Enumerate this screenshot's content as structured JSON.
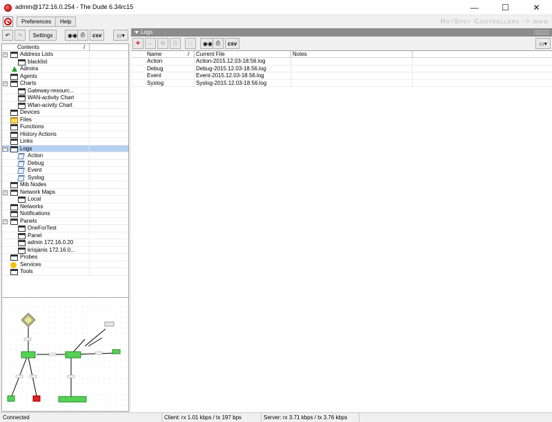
{
  "window": {
    "title": "admin@172.16.0.254 - The Dude 6.34rc15"
  },
  "menu": {
    "preferences": "Preferences",
    "help": "Help",
    "brand": "HotSpot Controllers -> www"
  },
  "left_toolbar": {
    "settings": "Settings",
    "csv": "csv"
  },
  "tree": {
    "header": "Contents",
    "items": [
      {
        "label": "Address Lists",
        "level": 0,
        "exp": "−",
        "icon": "window-icon"
      },
      {
        "label": "blacklist",
        "level": 1,
        "exp": "",
        "icon": "window-icon"
      },
      {
        "label": "Admins",
        "level": 0,
        "exp": "",
        "icon": "admin-icon"
      },
      {
        "label": "Agents",
        "level": 0,
        "exp": "",
        "icon": "window-icon"
      },
      {
        "label": "Charts",
        "level": 0,
        "exp": "−",
        "icon": "window-icon"
      },
      {
        "label": "Gateway-resourc...",
        "level": 1,
        "exp": "",
        "icon": "window-icon"
      },
      {
        "label": "WAN-activity Chart",
        "level": 1,
        "exp": "",
        "icon": "window-icon"
      },
      {
        "label": "Wlan-acivity Chart",
        "level": 1,
        "exp": "",
        "icon": "window-icon"
      },
      {
        "label": "Devices",
        "level": 0,
        "exp": "",
        "icon": "window-icon"
      },
      {
        "label": "Files",
        "level": 0,
        "exp": "",
        "icon": "folder-icon"
      },
      {
        "label": "Functions",
        "level": 0,
        "exp": "",
        "icon": "window-icon"
      },
      {
        "label": "History Actions",
        "level": 0,
        "exp": "",
        "icon": "window-icon"
      },
      {
        "label": "Links",
        "level": 0,
        "exp": "",
        "icon": "window-icon"
      },
      {
        "label": "Logs",
        "level": 0,
        "exp": "−",
        "icon": "window-icon",
        "selected": true
      },
      {
        "label": "Action",
        "level": 1,
        "exp": "",
        "icon": "log-icon"
      },
      {
        "label": "Debug",
        "level": 1,
        "exp": "",
        "icon": "log-icon"
      },
      {
        "label": "Event",
        "level": 1,
        "exp": "",
        "icon": "log-icon"
      },
      {
        "label": "Syslog",
        "level": 1,
        "exp": "",
        "icon": "log-icon"
      },
      {
        "label": "Mib Nodes",
        "level": 0,
        "exp": "",
        "icon": "window-icon"
      },
      {
        "label": "Network Maps",
        "level": 0,
        "exp": "−",
        "icon": "window-icon"
      },
      {
        "label": "Local",
        "level": 1,
        "exp": "",
        "icon": "window-icon"
      },
      {
        "label": "Networks",
        "level": 0,
        "exp": "",
        "icon": "window-icon"
      },
      {
        "label": "Notifications",
        "level": 0,
        "exp": "",
        "icon": "window-icon"
      },
      {
        "label": "Panels",
        "level": 0,
        "exp": "−",
        "icon": "window-icon"
      },
      {
        "label": "OneForTest",
        "level": 1,
        "exp": "",
        "icon": "window-icon"
      },
      {
        "label": "Panel",
        "level": 1,
        "exp": "",
        "icon": "window-icon"
      },
      {
        "label": "admin 172.16.0.20",
        "level": 1,
        "exp": "",
        "icon": "window-icon"
      },
      {
        "label": "krisjanis 172.16.0...",
        "level": 1,
        "exp": "",
        "icon": "window-icon"
      },
      {
        "label": "Probes",
        "level": 0,
        "exp": "",
        "icon": "window-icon"
      },
      {
        "label": "Services",
        "level": 0,
        "exp": "",
        "icon": "services-icon"
      },
      {
        "label": "Tools",
        "level": 0,
        "exp": "",
        "icon": "window-icon"
      }
    ]
  },
  "panel": {
    "title": "Logs",
    "csv": "csv",
    "columns": [
      "Name",
      "Current File",
      "Notes"
    ],
    "rows": [
      {
        "name": "Action",
        "file": "Action-2015.12.03-18.56.log",
        "notes": ""
      },
      {
        "name": "Debug",
        "file": "Debug-2015.12.03-18.56.log",
        "notes": ""
      },
      {
        "name": "Event",
        "file": "Event-2015.12.03-18.56.log",
        "notes": ""
      },
      {
        "name": "Syslog",
        "file": "Syslog-2015.12.03-18.56.log",
        "notes": ""
      }
    ]
  },
  "status": {
    "connection": "Connected",
    "client": "Client: rx 1.01 kbps / tx 197 bps",
    "server": "Server: rx 3.71 kbps / tx 3.76 kbps"
  },
  "colors": {
    "selection": "#b5cff0",
    "panel_header": "#8c8c8c",
    "device_up": "#55d155",
    "device_down": "#e02020"
  }
}
